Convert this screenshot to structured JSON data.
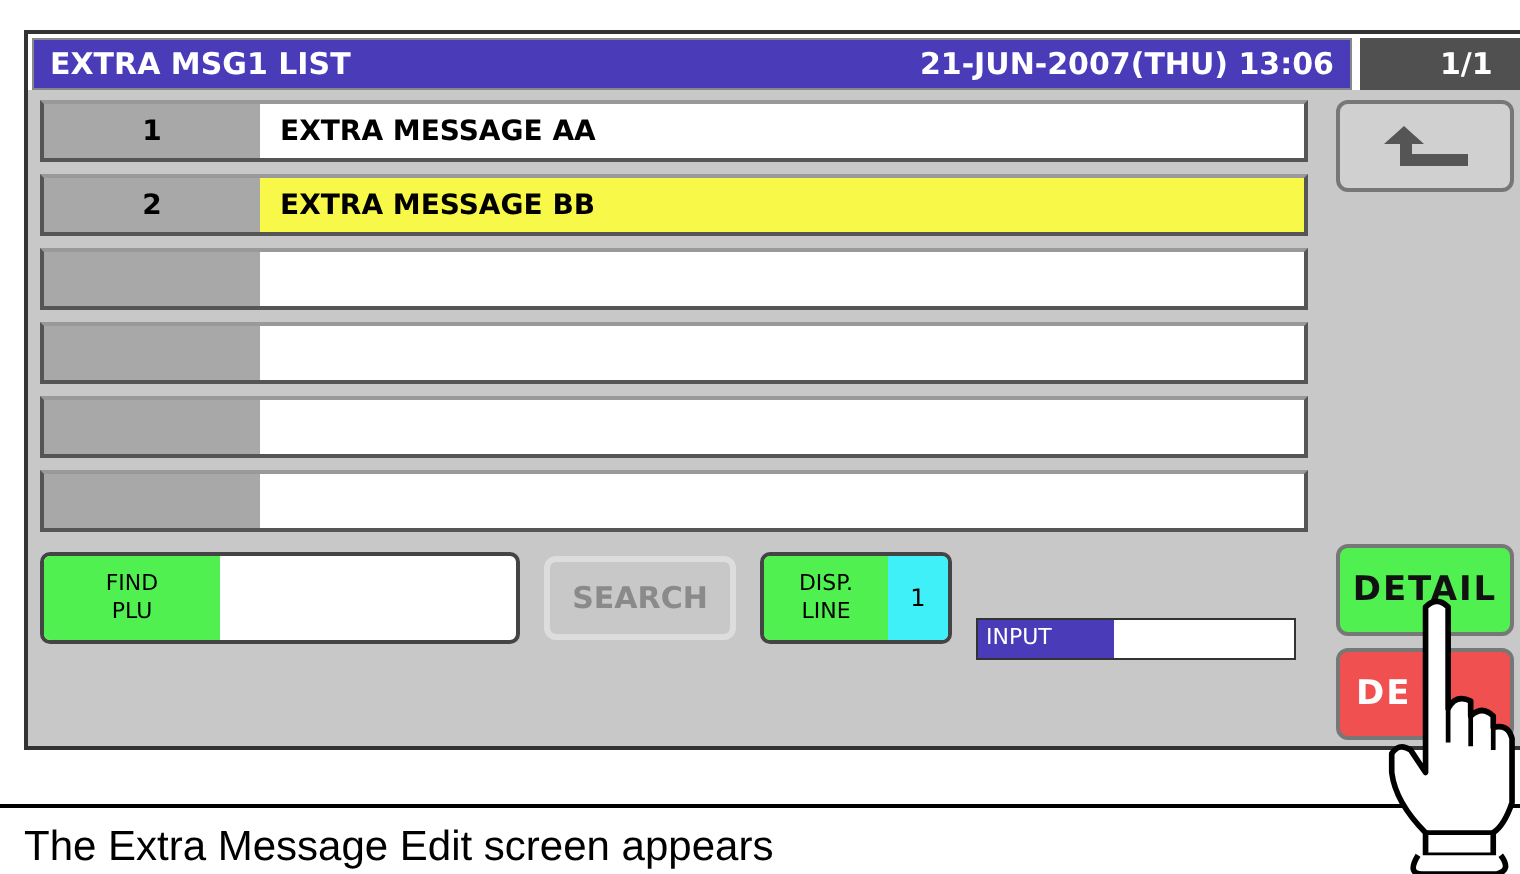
{
  "instructions": {
    "after": "The Extra Message Edit screen appears"
  },
  "header": {
    "title": "EXTRA MSG1 LIST",
    "datetime": "21-JUN-2007(THU) 13:06",
    "page": "1/1"
  },
  "rows": [
    {
      "number": "1",
      "text": "EXTRA MESSAGE AA",
      "selected": false
    },
    {
      "number": "2",
      "text": "EXTRA MESSAGE BB",
      "selected": true
    },
    {
      "selected": false
    },
    {
      "selected": false
    },
    {
      "selected": false
    },
    {
      "selected": false
    }
  ],
  "side_buttons": [
    {
      "kind": "back"
    },
    {
      "kind": "detail",
      "label": "DETAIL"
    },
    {
      "kind": "delete",
      "label": "DE"
    }
  ],
  "find": {
    "label": "FIND PLU"
  },
  "search": {
    "label": "SEARCH",
    "disabled": true
  },
  "disp_line": {
    "label": "DISP. LINE",
    "value": "1"
  },
  "input_indicator": {
    "label": "INPUT"
  }
}
